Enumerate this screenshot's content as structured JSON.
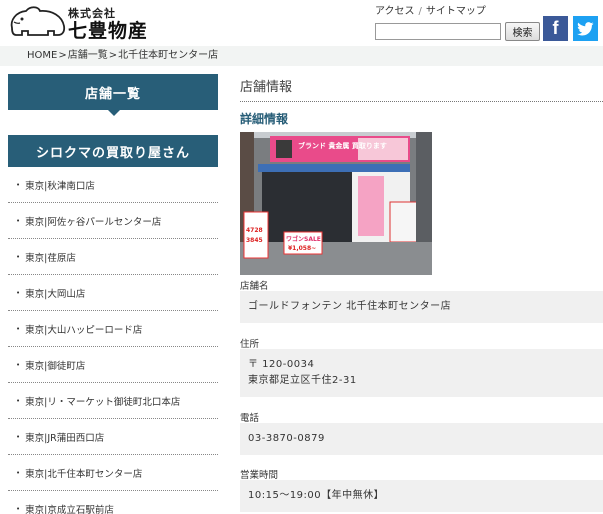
{
  "header": {
    "logo_small": "株式会社",
    "logo_big": "七豊物産",
    "links": [
      "アクセス",
      "サイトマップ"
    ],
    "link_separator": "/",
    "search_value": "",
    "search_button": "検索",
    "facebook_glyph": "f",
    "colors": {
      "facebook": "#3b5998",
      "twitter": "#1da1f2"
    }
  },
  "breadcrumb": {
    "items": [
      "HOME",
      "店舗一覧",
      "北千住本町センター店"
    ],
    "separator": ">"
  },
  "sidebar": {
    "heading1": "店舗一覧",
    "heading2": "シロクマの買取り屋さん",
    "items": [
      "東京|秋津南口店",
      "東京|阿佐ヶ谷パールセンター店",
      "東京|荏原店",
      "東京|大岡山店",
      "東京|大山ハッピーロード店",
      "東京|御徒町店",
      "東京|リ・マーケット御徒町北口本店",
      "東京|JR蒲田西口店",
      "東京|北千住本町センター店",
      "東京|京成立石駅前店"
    ],
    "colors": {
      "heading_bg": "#285e78"
    }
  },
  "main": {
    "section_title": "店舗情報",
    "detail_title": "詳細情報",
    "photo_signs": {
      "banner": "ブランド 貴金属 買取ります",
      "wagon": "ワゴンSALE",
      "price": "¥1,058~",
      "board_top": "4728",
      "board_mid": "3845"
    },
    "fields": [
      {
        "label": "店舗名",
        "lines": [
          "ゴールドフォンテン 北千住本町センター店"
        ]
      },
      {
        "label": "住所",
        "lines": [
          "〒 120-0034",
          "東京都足立区千住2-31"
        ]
      },
      {
        "label": "電話",
        "lines": [
          "03-3870-0879"
        ]
      },
      {
        "label": "営業時間",
        "lines": [
          "10:15～19:00【年中無休】"
        ]
      }
    ]
  }
}
